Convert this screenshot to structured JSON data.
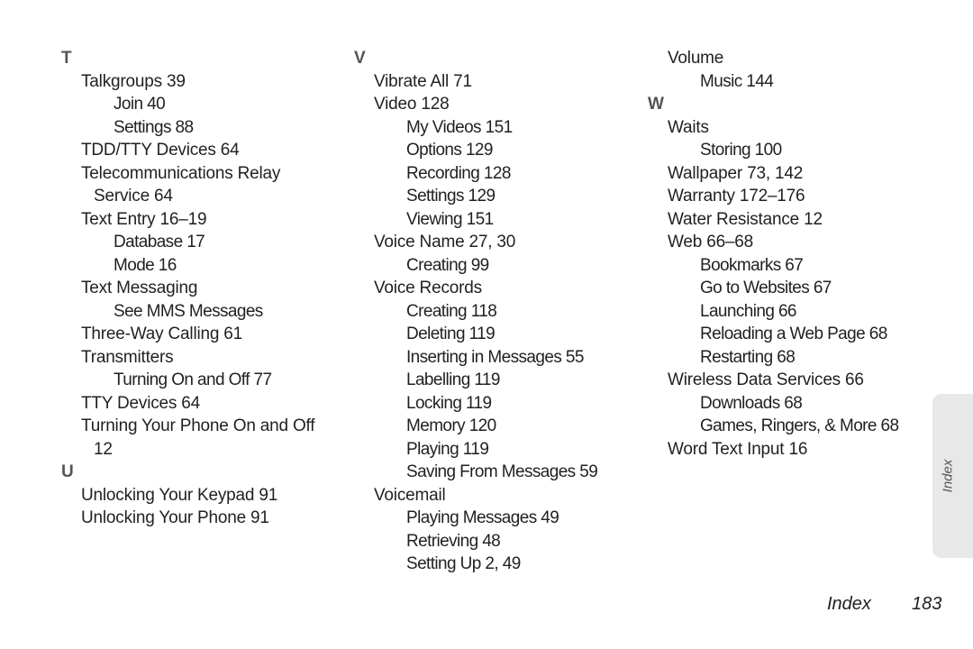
{
  "columns": [
    [
      {
        "type": "letter",
        "text": "T"
      },
      {
        "type": "l1",
        "text": "Talkgroups 39"
      },
      {
        "type": "l2",
        "text": "Join 40"
      },
      {
        "type": "l2",
        "text": "Settings 88"
      },
      {
        "type": "l1",
        "text": "TDD/TTY Devices 64"
      },
      {
        "type": "l1",
        "text": "Telecommunications Relay"
      },
      {
        "type": "l1c",
        "text": "Service 64"
      },
      {
        "type": "l1",
        "text": "Text Entry 16–19"
      },
      {
        "type": "l2",
        "text": "Database 17"
      },
      {
        "type": "l2",
        "text": "Mode 16"
      },
      {
        "type": "l1",
        "text": "Text Messaging"
      },
      {
        "type": "l2",
        "text": "See MMS Messages"
      },
      {
        "type": "l1",
        "text": "Three-Way Calling 61"
      },
      {
        "type": "l1",
        "text": "Transmitters"
      },
      {
        "type": "l2",
        "text": "Turning On and Off 77"
      },
      {
        "type": "l1",
        "text": "TTY Devices 64"
      },
      {
        "type": "l1",
        "text": "Turning Your Phone On and Off"
      },
      {
        "type": "l1c",
        "text": "12"
      },
      {
        "type": "letter",
        "text": "U"
      },
      {
        "type": "l1",
        "text": "Unlocking Your Keypad 91"
      },
      {
        "type": "l1",
        "text": "Unlocking Your Phone 91"
      }
    ],
    [
      {
        "type": "letter",
        "text": "V"
      },
      {
        "type": "l1",
        "text": "Vibrate All 71"
      },
      {
        "type": "l1",
        "text": "Video 128"
      },
      {
        "type": "l2",
        "text": "My Videos 151"
      },
      {
        "type": "l2",
        "text": "Options 129"
      },
      {
        "type": "l2",
        "text": "Recording 128"
      },
      {
        "type": "l2",
        "text": "Settings 129"
      },
      {
        "type": "l2",
        "text": "Viewing 151"
      },
      {
        "type": "l1",
        "text": "Voice Name 27, 30"
      },
      {
        "type": "l2",
        "text": "Creating 99"
      },
      {
        "type": "l1",
        "text": "Voice Records"
      },
      {
        "type": "l2",
        "text": "Creating 118"
      },
      {
        "type": "l2",
        "text": "Deleting 119"
      },
      {
        "type": "l2",
        "text": "Inserting in Messages 55"
      },
      {
        "type": "l2",
        "text": "Labelling 119"
      },
      {
        "type": "l2",
        "text": "Locking 119"
      },
      {
        "type": "l2",
        "text": "Memory 120"
      },
      {
        "type": "l2",
        "text": "Playing 119"
      },
      {
        "type": "l2",
        "text": "Saving From Messages 59"
      },
      {
        "type": "l1",
        "text": "Voicemail"
      },
      {
        "type": "l2",
        "text": "Playing Messages 49"
      },
      {
        "type": "l2",
        "text": "Retrieving 48"
      },
      {
        "type": "l2",
        "text": "Setting Up 2, 49"
      }
    ],
    [
      {
        "type": "l1",
        "text": "Volume"
      },
      {
        "type": "l2",
        "text": "Music 144"
      },
      {
        "type": "letter",
        "text": "W"
      },
      {
        "type": "l1",
        "text": "Waits"
      },
      {
        "type": "l2",
        "text": "Storing 100"
      },
      {
        "type": "l1",
        "text": "Wallpaper 73, 142"
      },
      {
        "type": "l1",
        "text": "Warranty 172–176"
      },
      {
        "type": "l1",
        "text": "Water Resistance 12"
      },
      {
        "type": "l1",
        "text": "Web 66–68"
      },
      {
        "type": "l2",
        "text": "Bookmarks 67"
      },
      {
        "type": "l2",
        "text": "Go to Websites 67"
      },
      {
        "type": "l2",
        "text": "Launching 66"
      },
      {
        "type": "l2",
        "text": "Reloading a Web Page 68"
      },
      {
        "type": "l2",
        "text": "Restarting 68"
      },
      {
        "type": "l1",
        "text": "Wireless Data Services 66"
      },
      {
        "type": "l2",
        "text": "Downloads 68"
      },
      {
        "type": "l2",
        "text": "Games, Ringers, & More 68"
      },
      {
        "type": "l1",
        "text": "Word Text Input 16"
      }
    ]
  ],
  "side_tab": {
    "label": "Index"
  },
  "footer": {
    "section": "Index",
    "page_number": "183"
  }
}
